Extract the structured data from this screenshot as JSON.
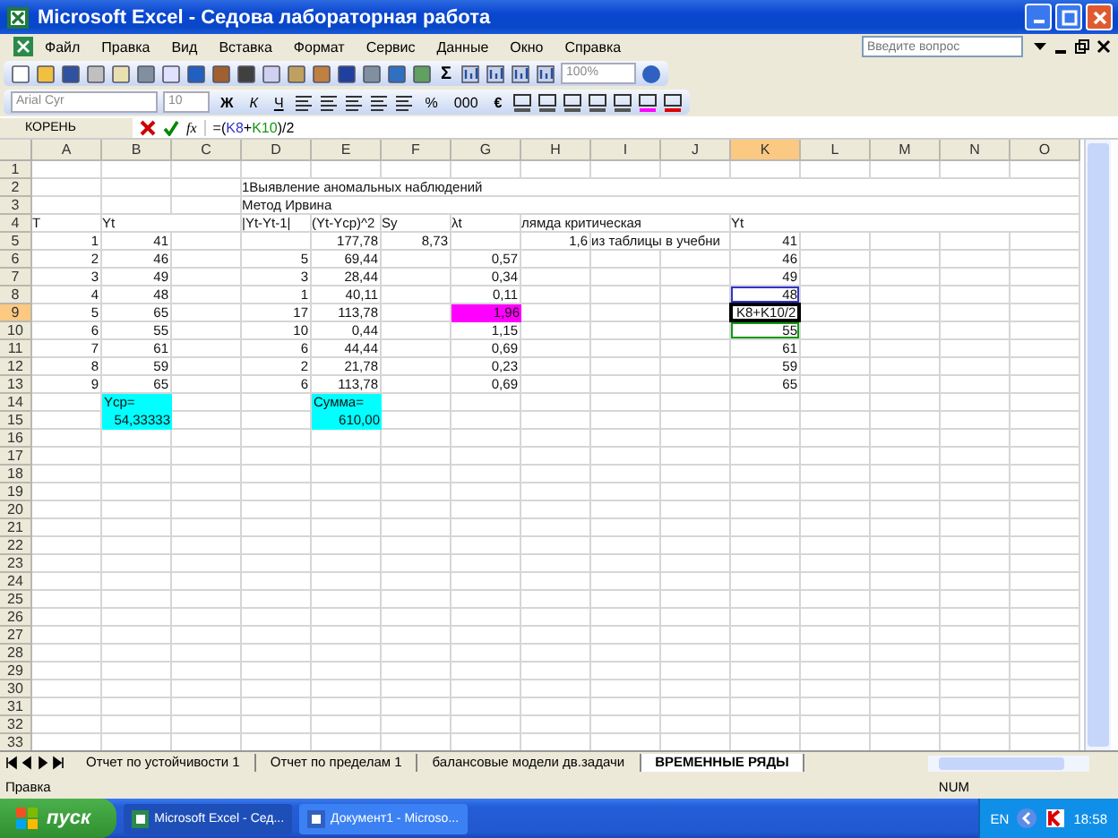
{
  "window": {
    "title": "Microsoft Excel - Седова лабораторная работа"
  },
  "menu": [
    "Файл",
    "Правка",
    "Вид",
    "Вставка",
    "Формат",
    "Сервис",
    "Данные",
    "Окно",
    "Справка"
  ],
  "help_search": {
    "placeholder": "Введите вопрос"
  },
  "standard_toolbar": {
    "sum": "Σ",
    "zoom": "100%"
  },
  "formatting_toolbar": {
    "font": "Arial Cyr",
    "size": "10",
    "style_buttons": [
      "Ж",
      "К",
      "Ч"
    ],
    "currency": "€",
    "percent": "%",
    "thousands": "000"
  },
  "formula_bar": {
    "name_box": "КОРЕНЬ",
    "function_label": "fx",
    "formula": [
      {
        "text": "=("
      },
      {
        "text": "K8",
        "color": "#3333cc"
      },
      {
        "text": "+"
      },
      {
        "text": "K10",
        "color": "#119911"
      },
      {
        "text": ")/2"
      }
    ]
  },
  "sheet": {
    "columns": [
      {
        "label": "A",
        "selected": false
      },
      {
        "label": "B",
        "selected": false
      },
      {
        "label": "C",
        "selected": false
      },
      {
        "label": "D",
        "selected": false
      },
      {
        "label": "E",
        "selected": false
      },
      {
        "label": "F",
        "selected": false
      },
      {
        "label": "G",
        "selected": false
      },
      {
        "label": "H",
        "selected": false
      },
      {
        "label": "I",
        "selected": false
      },
      {
        "label": "J",
        "selected": false
      },
      {
        "label": "K",
        "selected": true
      },
      {
        "label": "L",
        "selected": false
      },
      {
        "label": "M",
        "selected": false
      },
      {
        "label": "N",
        "selected": false
      },
      {
        "label": "O",
        "selected": false
      }
    ],
    "rows": [
      {
        "number": "1",
        "selected": false,
        "cells": {}
      },
      {
        "number": "2",
        "selected": false,
        "cells": {
          "D": {
            "text": "1Выявление аномальных наблюдений",
            "kind": "text"
          }
        }
      },
      {
        "number": "3",
        "selected": false,
        "cells": {
          "D": {
            "text": "Метод Ирвина",
            "kind": "text"
          }
        }
      },
      {
        "number": "4",
        "selected": false,
        "cells": {
          "A": {
            "text": "T",
            "kind": "text"
          },
          "B": {
            "text": "Yt",
            "kind": "text"
          },
          "D": {
            "text": "|Yt-Yt-1|",
            "kind": "text"
          },
          "E": {
            "text": "(Yt-Ycp)^2",
            "kind": "text"
          },
          "F": {
            "text": "Sy",
            "kind": "text"
          },
          "G": {
            "text": "λt",
            "kind": "text"
          },
          "H": {
            "text": "лямда критическая",
            "kind": "text"
          },
          "K": {
            "text": "Yt",
            "kind": "text"
          }
        }
      },
      {
        "number": "5",
        "selected": false,
        "cells": {
          "A": {
            "text": "1",
            "kind": "number"
          },
          "B": {
            "text": "41",
            "kind": "number"
          },
          "E": {
            "text": "177,78",
            "kind": "number"
          },
          "F": {
            "text": "8,73",
            "kind": "number"
          },
          "H": {
            "text": "1,6",
            "kind": "number"
          },
          "I": {
            "text": "из таблицы в учебни",
            "kind": "text"
          },
          "K": {
            "text": "41",
            "kind": "number"
          }
        }
      },
      {
        "number": "6",
        "selected": false,
        "cells": {
          "A": {
            "text": "2",
            "kind": "number"
          },
          "B": {
            "text": "46",
            "kind": "number"
          },
          "D": {
            "text": "5",
            "kind": "number"
          },
          "E": {
            "text": "69,44",
            "kind": "number"
          },
          "G": {
            "text": "0,57",
            "kind": "number"
          },
          "K": {
            "text": "46",
            "kind": "number"
          }
        }
      },
      {
        "number": "7",
        "selected": false,
        "cells": {
          "A": {
            "text": "3",
            "kind": "number"
          },
          "B": {
            "text": "49",
            "kind": "number"
          },
          "D": {
            "text": "3",
            "kind": "number"
          },
          "E": {
            "text": "28,44",
            "kind": "number"
          },
          "G": {
            "text": "0,34",
            "kind": "number"
          },
          "K": {
            "text": "49",
            "kind": "number"
          }
        }
      },
      {
        "number": "8",
        "selected": false,
        "cells": {
          "A": {
            "text": "4",
            "kind": "number"
          },
          "B": {
            "text": "48",
            "kind": "number"
          },
          "D": {
            "text": "1",
            "kind": "number"
          },
          "E": {
            "text": "40,11",
            "kind": "number"
          },
          "G": {
            "text": "0,11",
            "kind": "number"
          },
          "K": {
            "text": "48",
            "kind": "number",
            "reference": {
              "color": "#3333cc"
            }
          }
        }
      },
      {
        "number": "9",
        "selected": true,
        "cells": {
          "A": {
            "text": "5",
            "kind": "number"
          },
          "B": {
            "text": "65",
            "kind": "number"
          },
          "D": {
            "text": "17",
            "kind": "number"
          },
          "E": {
            "text": "113,78",
            "kind": "number"
          },
          "G": {
            "text": "1,96",
            "kind": "number",
            "color": "#ff00ff"
          },
          "K": {
            "text": "K8+K10/2",
            "kind": "editing"
          }
        }
      },
      {
        "number": "10",
        "selected": false,
        "cells": {
          "A": {
            "text": "6",
            "kind": "number"
          },
          "B": {
            "text": "55",
            "kind": "number"
          },
          "D": {
            "text": "10",
            "kind": "number"
          },
          "E": {
            "text": "0,44",
            "kind": "number"
          },
          "G": {
            "text": "1,15",
            "kind": "number"
          },
          "K": {
            "text": "55",
            "kind": "number",
            "reference": {
              "color": "#119911"
            }
          }
        }
      },
      {
        "number": "11",
        "selected": false,
        "cells": {
          "A": {
            "text": "7",
            "kind": "number"
          },
          "B": {
            "text": "61",
            "kind": "number"
          },
          "D": {
            "text": "6",
            "kind": "number"
          },
          "E": {
            "text": "44,44",
            "kind": "number"
          },
          "G": {
            "text": "0,69",
            "kind": "number"
          },
          "K": {
            "text": "61",
            "kind": "number"
          }
        }
      },
      {
        "number": "12",
        "selected": false,
        "cells": {
          "A": {
            "text": "8",
            "kind": "number"
          },
          "B": {
            "text": "59",
            "kind": "number"
          },
          "D": {
            "text": "2",
            "kind": "number"
          },
          "E": {
            "text": "21,78",
            "kind": "number"
          },
          "G": {
            "text": "0,23",
            "kind": "number"
          },
          "K": {
            "text": "59",
            "kind": "number"
          }
        }
      },
      {
        "number": "13",
        "selected": false,
        "cells": {
          "A": {
            "text": "9",
            "kind": "number"
          },
          "B": {
            "text": "65",
            "kind": "number"
          },
          "D": {
            "text": "6",
            "kind": "number"
          },
          "E": {
            "text": "113,78",
            "kind": "number"
          },
          "G": {
            "text": "0,69",
            "kind": "number"
          },
          "K": {
            "text": "65",
            "kind": "number"
          }
        }
      },
      {
        "number": "14",
        "selected": false,
        "cells": {
          "B": {
            "text": "Ycp=",
            "kind": "text",
            "color": "#00ffff"
          },
          "E": {
            "text": "Сумма=",
            "kind": "text",
            "color": "#00ffff"
          }
        }
      },
      {
        "number": "15",
        "selected": false,
        "cells": {
          "B": {
            "text": "54,33333",
            "kind": "number",
            "color": "#00ffff"
          },
          "E": {
            "text": "610,00",
            "kind": "number",
            "color": "#00ffff"
          }
        }
      },
      {
        "number": "16",
        "selected": false,
        "cells": {}
      },
      {
        "number": "17",
        "selected": false,
        "cells": {}
      },
      {
        "number": "18",
        "selected": false,
        "cells": {}
      },
      {
        "number": "19",
        "selected": false,
        "cells": {}
      },
      {
        "number": "20",
        "selected": false,
        "cells": {}
      },
      {
        "number": "21",
        "selected": false,
        "cells": {}
      },
      {
        "number": "22",
        "selected": false,
        "cells": {}
      },
      {
        "number": "23",
        "selected": false,
        "cells": {}
      },
      {
        "number": "24",
        "selected": false,
        "cells": {}
      },
      {
        "number": "25",
        "selected": false,
        "cells": {}
      },
      {
        "number": "26",
        "selected": false,
        "cells": {}
      },
      {
        "number": "27",
        "selected": false,
        "cells": {}
      },
      {
        "number": "28",
        "selected": false,
        "cells": {}
      },
      {
        "number": "29",
        "selected": false,
        "cells": {}
      },
      {
        "number": "30",
        "selected": false,
        "cells": {}
      },
      {
        "number": "31",
        "selected": false,
        "cells": {}
      },
      {
        "number": "32",
        "selected": false,
        "cells": {}
      },
      {
        "number": "33",
        "selected": false,
        "cells": {}
      }
    ]
  },
  "sheet_tabs": [
    {
      "label": "Отчет по устойчивости 1",
      "selected": false
    },
    {
      "label": "Отчет по пределам 1",
      "selected": false
    },
    {
      "label": "балансовые модели дв.задачи",
      "selected": false
    },
    {
      "label": "ВРЕМЕННЫЕ РЯДЫ",
      "selected": true
    }
  ],
  "status_bar": {
    "mode": "Правка",
    "indicator": "NUM"
  },
  "taskbar": {
    "start": "пуск",
    "tasks": [
      {
        "label": "Microsoft Excel - Сед...",
        "selected": true
      },
      {
        "label": "Документ1 - Microso...",
        "selected": false
      }
    ],
    "language": "EN",
    "clock": "18:58"
  }
}
